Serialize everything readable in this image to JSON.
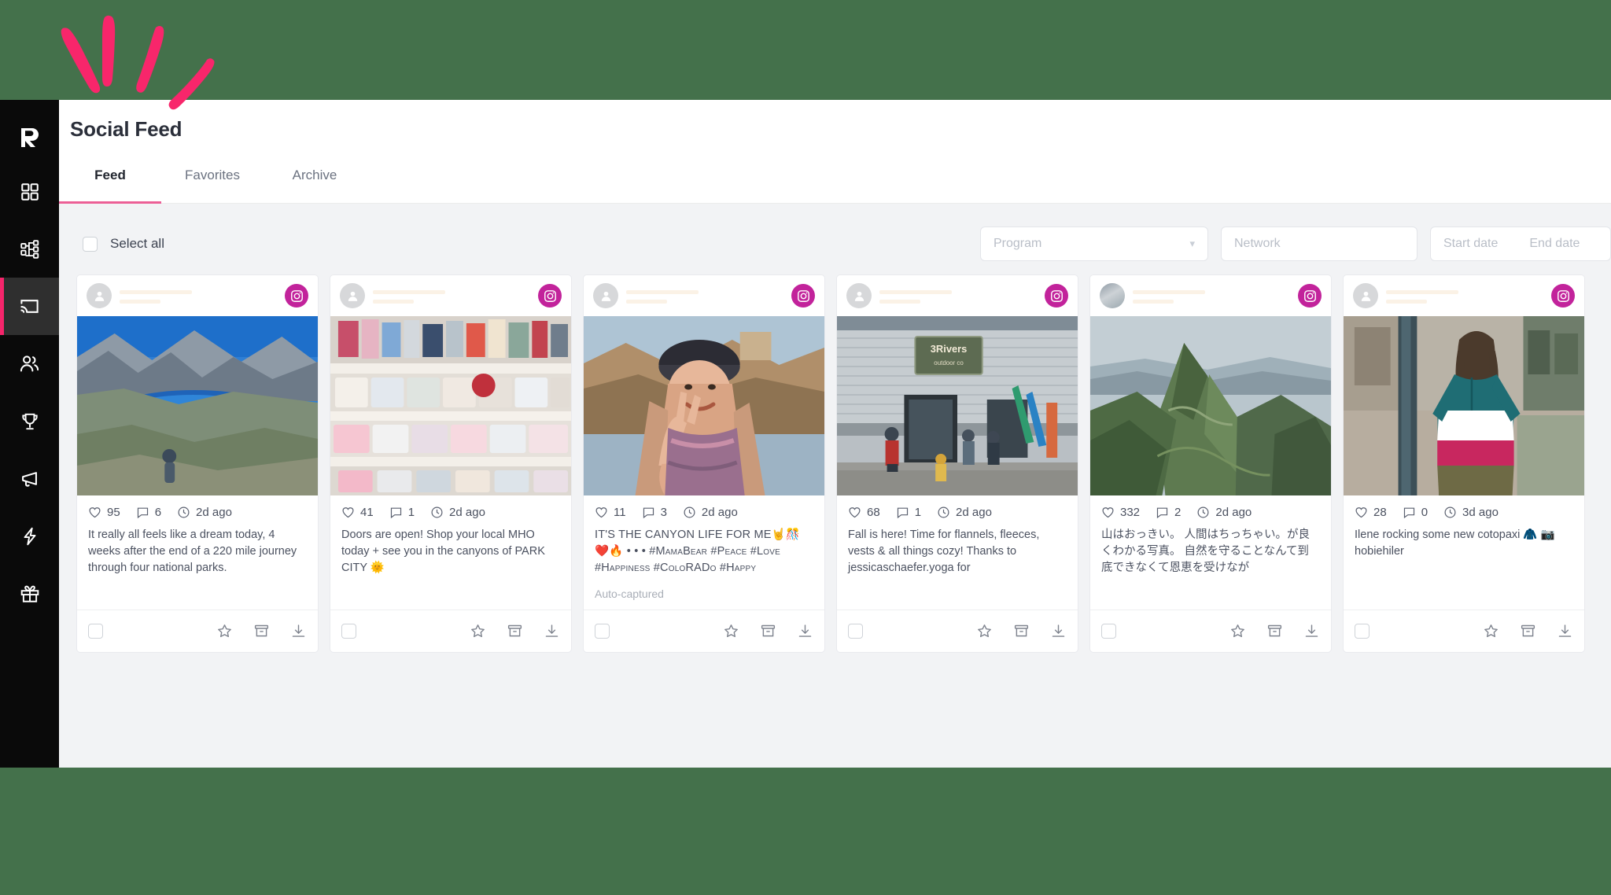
{
  "colors": {
    "page_background": "#44714b",
    "sidebar_background": "#0a0a0a",
    "accent_pink": "#f5256b",
    "tab_underline": "#ec5f96",
    "instagram_badge": "#c2239b",
    "content_background": "#f2f3f5"
  },
  "sidebar": {
    "logo": "rival-iq-logo",
    "items": [
      {
        "name": "dashboard",
        "icon": "grid-icon",
        "active": false
      },
      {
        "name": "reports",
        "icon": "hierarchy-icon",
        "active": false
      },
      {
        "name": "social-feed",
        "icon": "cast-icon",
        "active": true
      },
      {
        "name": "audience",
        "icon": "people-icon",
        "active": false
      },
      {
        "name": "competitive",
        "icon": "trophy-icon",
        "active": false
      },
      {
        "name": "campaigns",
        "icon": "megaphone-icon",
        "active": false
      },
      {
        "name": "boost",
        "icon": "lightning-icon",
        "active": false
      },
      {
        "name": "rewards",
        "icon": "gift-icon",
        "active": false
      }
    ]
  },
  "header": {
    "title": "Social Feed"
  },
  "tabs": [
    {
      "label": "Feed",
      "active": true
    },
    {
      "label": "Favorites",
      "active": false
    },
    {
      "label": "Archive",
      "active": false
    }
  ],
  "toolbar": {
    "select_all_label": "Select all",
    "program_placeholder": "Program",
    "network_placeholder": "Network",
    "start_date_placeholder": "Start date",
    "end_date_placeholder": "End date"
  },
  "cards": [
    {
      "network": "instagram",
      "avatar_type": "placeholder",
      "username_redacted": true,
      "likes": "95",
      "comments": "6",
      "time": "2d ago",
      "caption": "It really all feels like a dream today, 4 weeks after the end of a 220 mile journey through four national parks.",
      "caption_style": "normal",
      "auto_captured": null,
      "image_alt": "hiker-overlooking-alpine-lake"
    },
    {
      "network": "instagram",
      "avatar_type": "placeholder",
      "username_redacted": true,
      "likes": "41",
      "comments": "1",
      "time": "2d ago",
      "caption": "Doors are open! Shop your local MHO today + see you in the canyons of PARK CITY 🌞",
      "caption_style": "normal",
      "auto_captured": null,
      "image_alt": "retail-store-shelves-of-apparel"
    },
    {
      "network": "instagram",
      "avatar_type": "placeholder",
      "username_redacted": true,
      "likes": "11",
      "comments": "3",
      "time": "2d ago",
      "caption": "IT'S THE CANYON LIFE FOR ME🤘🎊❤️🔥 • • • #MamaBear #Peace #Love #Happiness #ColoRADo #Happy",
      "caption_style": "smallcaps",
      "auto_captured": "Auto-captured",
      "image_alt": "cyclist-in-helmet-making-peace-sign"
    },
    {
      "network": "instagram",
      "avatar_type": "placeholder",
      "username_redacted": true,
      "likes": "68",
      "comments": "1",
      "time": "2d ago",
      "caption": "Fall is here! Time for flannels, fleeces, vests & all things cozy! Thanks to jessicaschaefer.yoga for",
      "caption_style": "normal",
      "auto_captured": null,
      "image_alt": "people-outside-3rivers-outdoor-shop"
    },
    {
      "network": "instagram",
      "avatar_type": "photo",
      "username_redacted": true,
      "likes": "332",
      "comments": "2",
      "time": "2d ago",
      "caption": "山はおっきい。 人間はちっちゃい。が良くわかる写真。 自然を守ることなんて到底できなくて恩恵を受けなが",
      "caption_style": "normal",
      "auto_captured": null,
      "image_alt": "green-mountain-ridge-line"
    },
    {
      "network": "instagram",
      "avatar_type": "placeholder",
      "username_redacted": true,
      "likes": "28",
      "comments": "0",
      "time": "3d ago",
      "caption": "Ilene rocking some new cotopaxi 🧥 📷 hobiehiler",
      "caption_style": "normal",
      "auto_captured": null,
      "image_alt": "woman-in-colorblock-jacket-on-street"
    }
  ],
  "card_footer": {
    "select_icon": "checkbox-icon",
    "favorite_icon": "star-icon",
    "archive_icon": "archive-icon",
    "download_icon": "download-icon"
  },
  "stat_icons": {
    "likes": "heart-icon",
    "comments": "comment-icon",
    "time": "clock-icon"
  }
}
